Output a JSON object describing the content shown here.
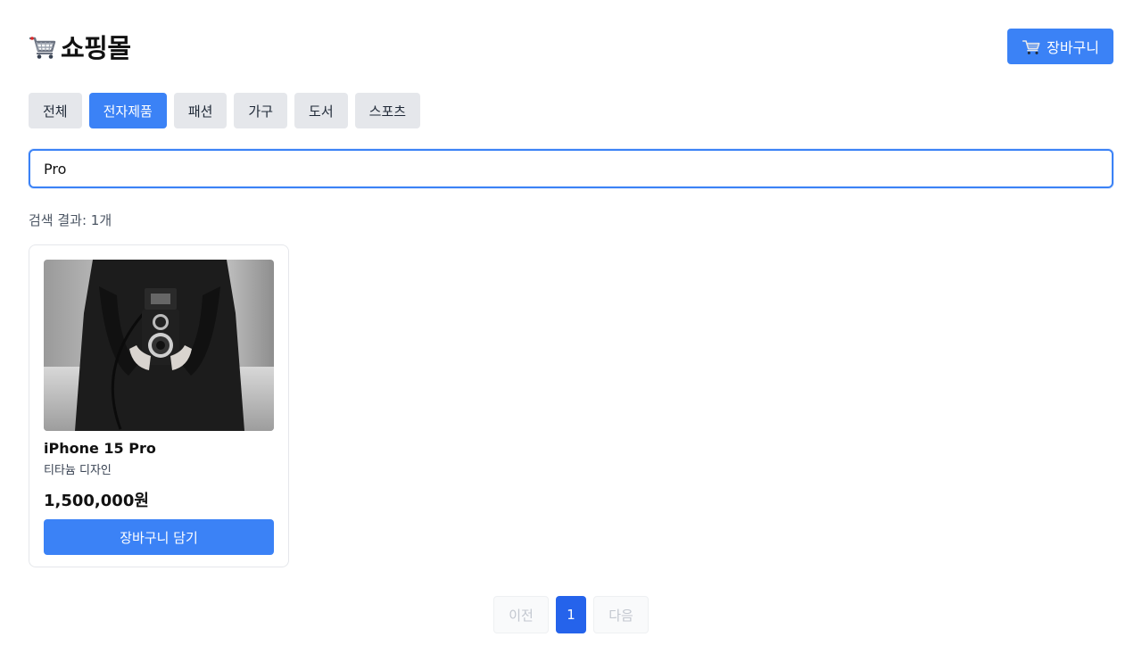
{
  "header": {
    "brand_icon": "shopping-cart-icon",
    "title": "쇼핑몰",
    "cart_button_label": "장바구니",
    "cart_button_icon": "shopping-cart-icon"
  },
  "categories": [
    {
      "label": "전체",
      "active": false
    },
    {
      "label": "전자제품",
      "active": true
    },
    {
      "label": "패션",
      "active": false
    },
    {
      "label": "가구",
      "active": false
    },
    {
      "label": "도서",
      "active": false
    },
    {
      "label": "스포츠",
      "active": false
    }
  ],
  "search": {
    "value": "Pro"
  },
  "results": {
    "count_text": "검색 결과: 1개"
  },
  "products": [
    {
      "name": "iPhone 15 Pro",
      "description": "티타늄 디자인",
      "price": "1,500,000원",
      "button_label": "장바구니 담기"
    }
  ],
  "pagination": {
    "prev_label": "이전",
    "current_page": "1",
    "next_label": "다음"
  },
  "colors": {
    "accent": "#3b82f6",
    "active_page": "#2563eb",
    "category_bg": "#e5e7eb"
  }
}
